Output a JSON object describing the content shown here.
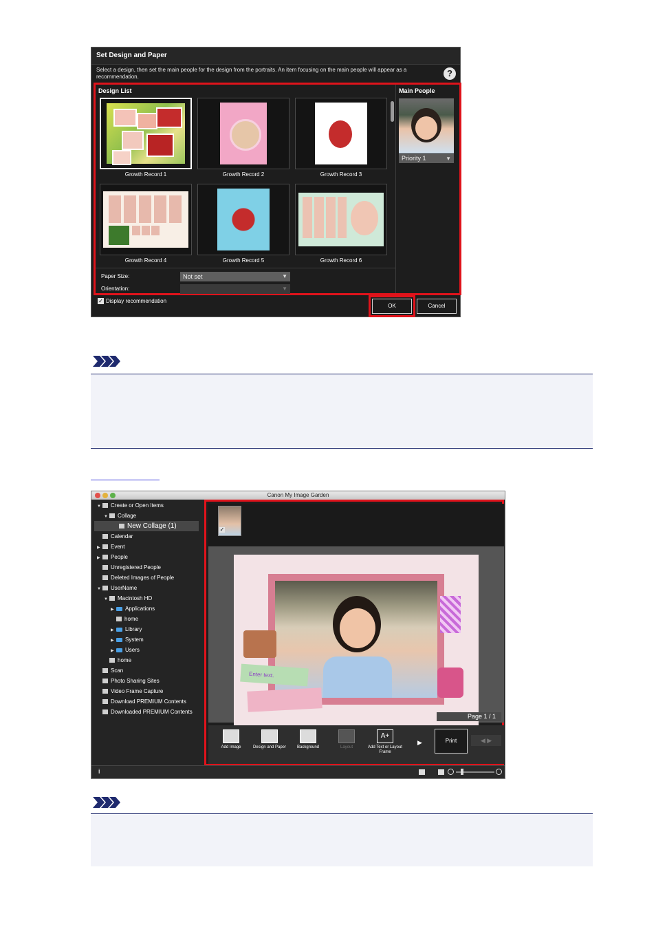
{
  "dialog": {
    "title": "Set Design and Paper",
    "description": "Select a design, then set the main people for the design from the portraits. An item focusing on the main people will appear as a recommendation.",
    "help_icon": "?",
    "design_list_label": "Design List",
    "designs": [
      {
        "label": "Growth Record 1",
        "selected": true
      },
      {
        "label": "Growth Record 2",
        "selected": false
      },
      {
        "label": "Growth Record 3",
        "selected": false
      },
      {
        "label": "Growth Record 4",
        "selected": false
      },
      {
        "label": "Growth Record 5",
        "selected": false
      },
      {
        "label": "Growth Record 6",
        "selected": false
      }
    ],
    "main_people_label": "Main People",
    "priority": "Priority 1",
    "paper_size_label": "Paper Size:",
    "paper_size_value": "Not set",
    "orientation_label": "Orientation:",
    "orientation_value": "",
    "display_recommendation": "Display recommendation",
    "display_recommendation_checked": true,
    "ok_label": "OK",
    "cancel_label": "Cancel",
    "highlight_color": "#e0131b"
  },
  "app": {
    "title": "Canon My Image Garden",
    "sidebar": [
      {
        "label": "Create or Open Items",
        "level": 0,
        "twisty": "open"
      },
      {
        "label": "Collage",
        "level": 1,
        "twisty": "open"
      },
      {
        "label": "New Collage (1)",
        "level": 2,
        "twisty": "",
        "selected": true
      },
      {
        "label": "Calendar",
        "level": 0,
        "twisty": ""
      },
      {
        "label": "Event",
        "level": 0,
        "twisty": "closed"
      },
      {
        "label": "People",
        "level": 0,
        "twisty": "closed"
      },
      {
        "label": "Unregistered People",
        "level": 0,
        "twisty": ""
      },
      {
        "label": "Deleted Images of People",
        "level": 0,
        "twisty": ""
      },
      {
        "label": "UserName",
        "level": 0,
        "twisty": "open"
      },
      {
        "label": "Macintosh HD",
        "level": 1,
        "twisty": "open"
      },
      {
        "label": "Applications",
        "level": 2,
        "twisty": "closed",
        "folder": true
      },
      {
        "label": "home",
        "level": 2,
        "twisty": ""
      },
      {
        "label": "Library",
        "level": 2,
        "twisty": "closed",
        "folder": true
      },
      {
        "label": "System",
        "level": 2,
        "twisty": "closed",
        "folder": true
      },
      {
        "label": "Users",
        "level": 2,
        "twisty": "closed",
        "folder": true
      },
      {
        "label": "home",
        "level": 1,
        "twisty": ""
      },
      {
        "label": "Scan",
        "level": 0,
        "twisty": ""
      },
      {
        "label": "Photo Sharing Sites",
        "level": 0,
        "twisty": ""
      },
      {
        "label": "Video Frame Capture",
        "level": 0,
        "twisty": ""
      },
      {
        "label": "Download PREMIUM Contents",
        "level": 0,
        "twisty": ""
      },
      {
        "label": "Downloaded PREMIUM Contents",
        "level": 0,
        "twisty": ""
      }
    ],
    "canvas_text": "Enter text.",
    "page_indicator": "Page 1 / 1",
    "tools": [
      {
        "label": "Add Image",
        "icon": "add-image-icon",
        "enabled": true
      },
      {
        "label": "Design and Paper",
        "icon": "design-paper-icon",
        "enabled": true
      },
      {
        "label": "Background",
        "icon": "background-icon",
        "enabled": true
      },
      {
        "label": "Layout",
        "icon": "layout-icon",
        "enabled": false
      },
      {
        "label": "Add Text or Layout Frame",
        "icon": "add-text-icon",
        "enabled": true
      }
    ],
    "print_label": "Print",
    "status_info": "i"
  }
}
